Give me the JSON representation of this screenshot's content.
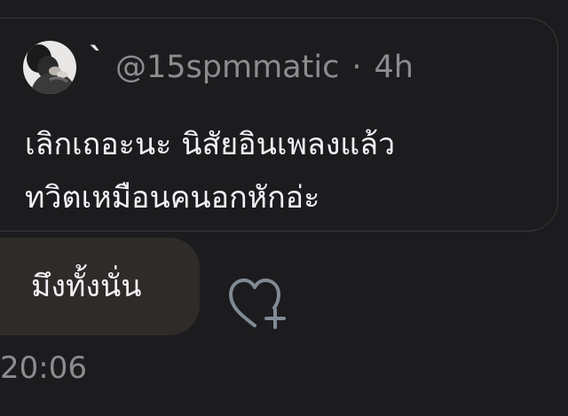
{
  "quoted_tweet": {
    "display_name": "`",
    "handle": "@15spmmatic",
    "separator": "·",
    "time_ago": "4h",
    "text": "เลิกเถอะนะ นิสัยอินเพลงแล้ว\nทวิตเหมือนคนอกหักอ่ะ",
    "avatar_icon": "profile-photo"
  },
  "reply": {
    "text": "มึงทั้งนั่น",
    "time": "20:06"
  },
  "reaction": {
    "icon": "heart-add-icon"
  },
  "colors": {
    "background": "#1c1b1d",
    "card_border": "#3a393c",
    "bubble": "#2e2b29",
    "primary_text": "#f2f0f4",
    "secondary_text": "#8e8b8f",
    "icon_stroke": "#7f8a94"
  }
}
